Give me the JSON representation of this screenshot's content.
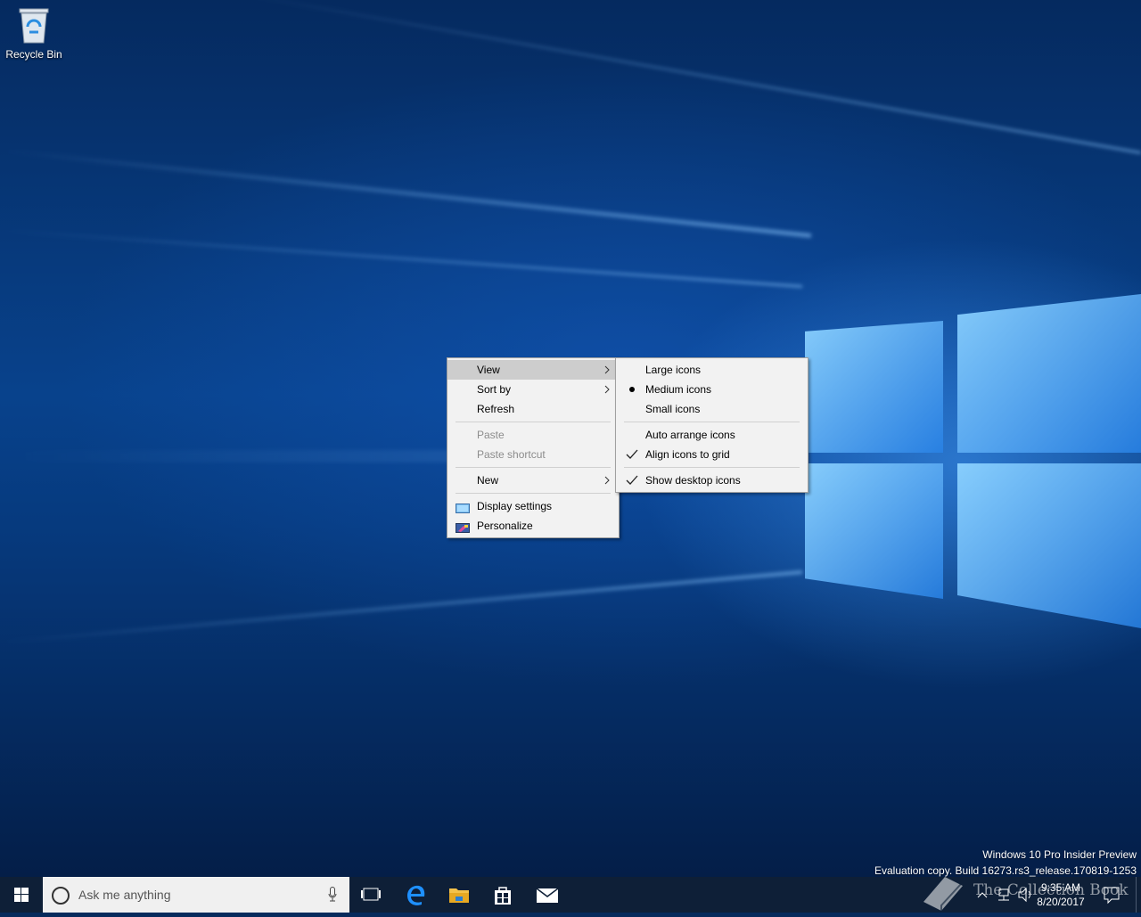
{
  "desktop": {
    "recycle_bin_label": "Recycle Bin"
  },
  "context_menu": {
    "items": [
      {
        "label": "View",
        "has_submenu": true,
        "highlighted": true
      },
      {
        "label": "Sort by",
        "has_submenu": true
      },
      {
        "label": "Refresh"
      },
      {
        "label": "Paste",
        "disabled": true
      },
      {
        "label": "Paste shortcut",
        "disabled": true
      },
      {
        "label": "New",
        "has_submenu": true
      },
      {
        "label": "Display settings",
        "icon": "display-settings-icon"
      },
      {
        "label": "Personalize",
        "icon": "personalize-icon"
      }
    ]
  },
  "view_submenu": {
    "items": [
      {
        "label": "Large icons"
      },
      {
        "label": "Medium icons",
        "mark": "bullet"
      },
      {
        "label": "Small icons"
      },
      {
        "label": "Auto arrange icons"
      },
      {
        "label": "Align icons to grid",
        "mark": "check"
      },
      {
        "label": "Show desktop icons",
        "mark": "check"
      }
    ]
  },
  "watermark": {
    "line1": "Windows 10 Pro Insider Preview",
    "line2": "Evaluation copy. Build 16273.rs3_release.170819-1253"
  },
  "taskbar": {
    "search_placeholder": "Ask me anything",
    "clock_time": "9:35 AM",
    "clock_date": "8/20/2017",
    "pinned_icons": [
      "task-view-icon",
      "edge-icon",
      "file-explorer-icon",
      "store-icon",
      "mail-icon"
    ],
    "overlay_text": "The Collection Book"
  },
  "colors": {
    "menu_bg": "#f2f2f2",
    "menu_highlight": "#cdcdcd",
    "taskbar_bg": "#0e1f37",
    "accent": "#0078d7"
  }
}
